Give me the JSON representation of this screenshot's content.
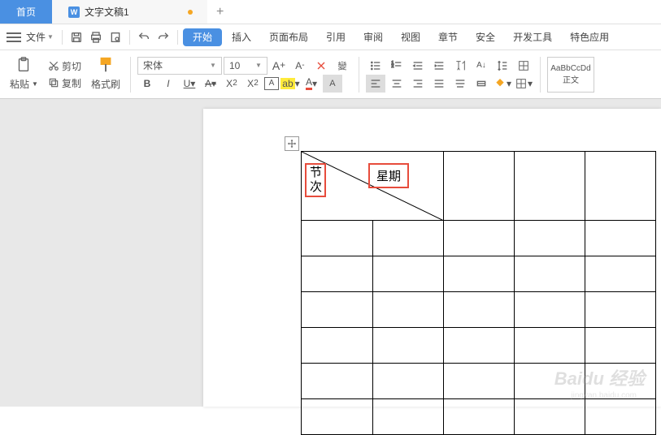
{
  "tabs": {
    "home": "首页",
    "doc": "文字文稿1",
    "docicon": "W"
  },
  "menu": {
    "file": "文件",
    "tabs": [
      "开始",
      "插入",
      "页面布局",
      "引用",
      "审阅",
      "视图",
      "章节",
      "安全",
      "开发工具",
      "特色应用"
    ],
    "active": 0
  },
  "ribbon": {
    "paste": "粘贴",
    "cut": "剪切",
    "copy": "复制",
    "format_painter": "格式刷",
    "font_name": "宋体",
    "font_size": "10",
    "style_sample": "AaBbCcDd",
    "style_name": "正文"
  },
  "document": {
    "label1": "节次",
    "label2": "星期",
    "cols": 5,
    "rows": 7
  },
  "watermark": {
    "main": "Baidu 经验",
    "sub": "jingyan.baidu.com"
  }
}
